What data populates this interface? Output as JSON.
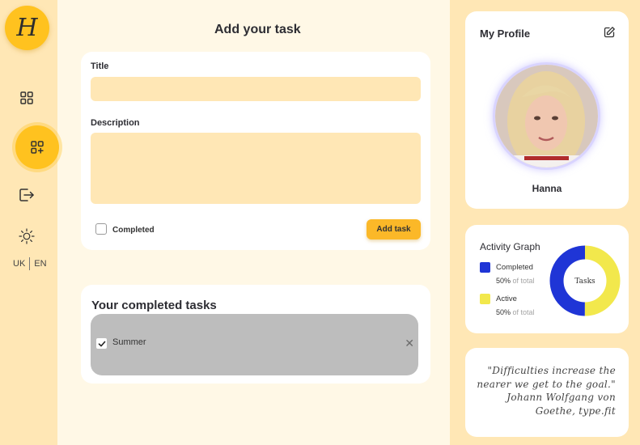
{
  "app": {
    "logo_letter": "H",
    "brand_color": "#ffc21f"
  },
  "sidebar": {
    "items": [
      {
        "icon": "dashboard-grid-icon",
        "active": false
      },
      {
        "icon": "add-task-grid-icon",
        "active": true
      },
      {
        "icon": "logout-icon",
        "active": false
      },
      {
        "icon": "sun-icon",
        "active": false
      }
    ],
    "lang": {
      "uk": "UK",
      "en": "EN"
    }
  },
  "form": {
    "heading": "Add your task",
    "title_label": "Title",
    "title_value": "",
    "description_label": "Description",
    "description_value": "",
    "completed_label": "Completed",
    "completed_checked": false,
    "submit_label": "Add task"
  },
  "completed_tasks": {
    "heading": "Your completed tasks",
    "items": [
      {
        "text": "Summer",
        "checked": true
      }
    ]
  },
  "profile": {
    "heading": "My Profile",
    "name": "Hanna"
  },
  "activity": {
    "heading": "Activity Graph",
    "center_label": "Tasks",
    "legend": [
      {
        "name": "Completed",
        "percent": "50%",
        "suffix": "of total",
        "color": "#1f35d6"
      },
      {
        "name": "Active",
        "percent": "50%",
        "suffix": "of total",
        "color": "#f2e84c"
      }
    ],
    "chart_data": {
      "type": "pie",
      "categories": [
        "Completed",
        "Active"
      ],
      "values": [
        50,
        50
      ]
    }
  },
  "quote": {
    "lines": [
      "\"Difficulties increase the",
      "nearer we get to the goal.\"",
      "Johann Wolfgang von",
      "Goethe, type.fit"
    ]
  }
}
